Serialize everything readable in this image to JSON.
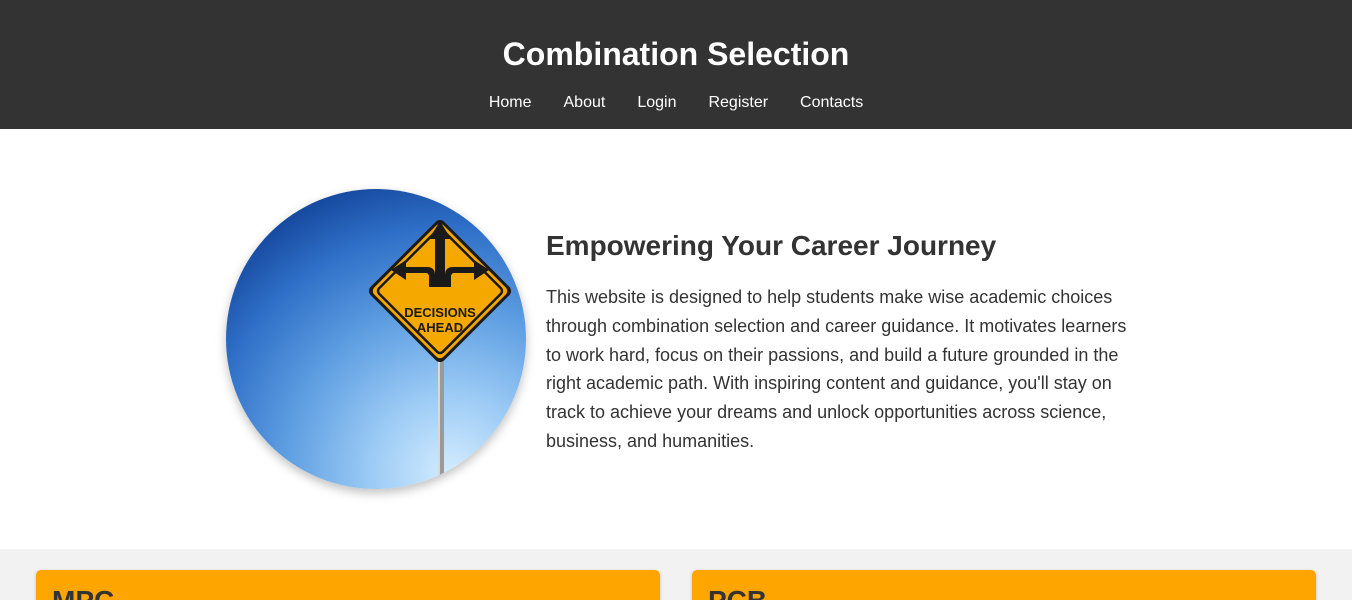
{
  "header": {
    "title": "Combination Selection",
    "nav": [
      "Home",
      "About",
      "Login",
      "Register",
      "Contacts"
    ]
  },
  "hero": {
    "image": {
      "icon": "decisions-ahead-road-sign",
      "sign_text_line1": "DECISIONS",
      "sign_text_line2": "AHEAD"
    },
    "heading": "Empowering Your Career Journey",
    "paragraph": "This website is designed to help students make wise academic choices through combination selection and career guidance. It motivates learners to work hard, focus on their passions, and build a future grounded in the right academic path. With inspiring content and guidance, you'll stay on track to achieve your dreams and unlock opportunities across science, business, and humanities."
  },
  "combinations": {
    "cards": [
      {
        "title": "MPC"
      },
      {
        "title": "PCB"
      }
    ]
  },
  "colors": {
    "header_bg": "#333333",
    "card_bg": "#ffa500",
    "section_bg": "#f2f2f2",
    "sign_yellow": "#f5a800"
  }
}
